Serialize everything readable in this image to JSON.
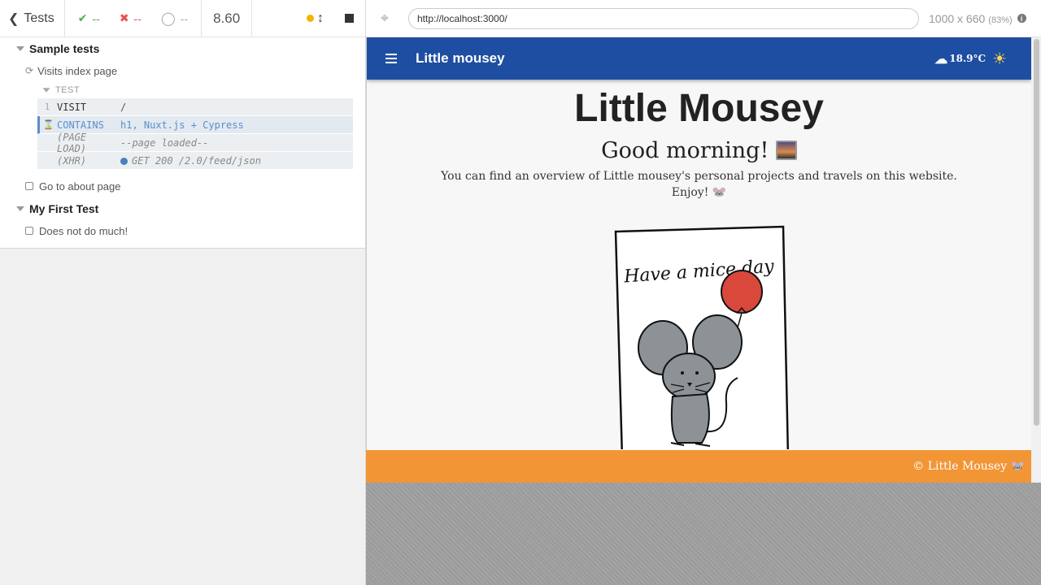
{
  "reporter": {
    "back_label": "Tests",
    "stats": {
      "passed": "--",
      "failed": "--",
      "pending": "--"
    },
    "duration": "8.60",
    "suites": [
      {
        "title": "Sample tests",
        "tests": [
          {
            "title": "Visits index page",
            "hook": "TEST",
            "commands": [
              {
                "num": "1",
                "name": "VISIT",
                "msg": "/"
              },
              {
                "num": "",
                "name": "CONTAINS",
                "msg": "h1, Nuxt.js + Cypress"
              },
              {
                "num": "",
                "name": "(PAGE LOAD)",
                "msg": "--page loaded--"
              },
              {
                "num": "",
                "name": "(XHR)",
                "msg": "GET 200 /2.0/feed/json"
              }
            ]
          },
          {
            "title": "Go to about page"
          }
        ]
      },
      {
        "title": "My First Test",
        "tests": [
          {
            "title": "Does not do much!"
          }
        ]
      }
    ]
  },
  "aut": {
    "url": "http://localhost:3000/",
    "viewport": "1000 x 660",
    "scale": "(83%)"
  },
  "app": {
    "bar_title": "Little mousey",
    "weather": "18.9°C",
    "title": "Little Mousey",
    "greeting": "Good morning!",
    "description_line1": "You can find an overview of Little mousey's personal projects and travels on this website.",
    "description_line2": "Enjoy!",
    "card_text": "Have a mice day",
    "footer": "© Little Mousey",
    "colors": {
      "app_bar": "#1e4ea1",
      "footer": "#f29535",
      "balloon": "#d9483b"
    }
  }
}
